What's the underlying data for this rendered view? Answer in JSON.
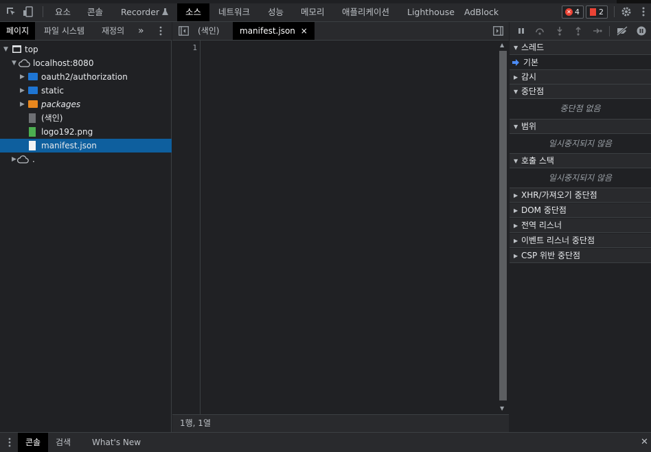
{
  "toolbar": {
    "tabs": [
      {
        "label": "요소"
      },
      {
        "label": "콘솔"
      },
      {
        "label": "Recorder"
      },
      {
        "label": "소스"
      },
      {
        "label": "네트워크"
      },
      {
        "label": "성능"
      },
      {
        "label": "메모리"
      },
      {
        "label": "애플리케이션"
      },
      {
        "label": "Lighthouse"
      },
      {
        "label": "AdBlock"
      }
    ],
    "active_tab": "소스",
    "error_count": "4",
    "issue_count": "2"
  },
  "navigator": {
    "tabs": [
      {
        "label": "페이지"
      },
      {
        "label": "파일 시스템"
      },
      {
        "label": "재정의"
      }
    ],
    "more_label": "»",
    "tree": [
      {
        "label": "top"
      },
      {
        "label": "localhost:8080"
      },
      {
        "label": "oauth2/authorization"
      },
      {
        "label": "static"
      },
      {
        "label": "packages"
      },
      {
        "label": "(색인)"
      },
      {
        "label": "logo192.png"
      },
      {
        "label": "manifest.json"
      },
      {
        "label": "."
      }
    ],
    "selected": "manifest.json"
  },
  "editor": {
    "tabs": [
      {
        "label": "(색인)"
      },
      {
        "label": "manifest.json"
      }
    ],
    "close_glyph": "×",
    "line_numbers": [
      "1"
    ],
    "status": "1행, 1열"
  },
  "debugger": {
    "sections": {
      "threads": "스레드",
      "thread_main": "기본",
      "watch": "감시",
      "breakpoints": "중단점",
      "breakpoints_empty": "중단점 없음",
      "scope": "범위",
      "scope_empty": "일시중지되지 않음",
      "callstack": "호출 스택",
      "callstack_empty": "일시중지되지 않음",
      "xhr": "XHR/가져오기 중단점",
      "dom": "DOM 중단점",
      "global": "전역 리스너",
      "event": "이벤트 리스너 중단점",
      "csp": "CSP 위반 중단점"
    }
  },
  "drawer": {
    "tabs": [
      {
        "label": "콘솔"
      },
      {
        "label": "검색"
      },
      {
        "label": "What's New"
      }
    ],
    "close_glyph": "✕"
  },
  "colors": {
    "background": "#202124",
    "selection": "#0e5f9e",
    "error": "#ea4335",
    "folder_blue": "#1e75d3",
    "folder_orange": "#e8871e",
    "image_file": "#4caf50"
  }
}
